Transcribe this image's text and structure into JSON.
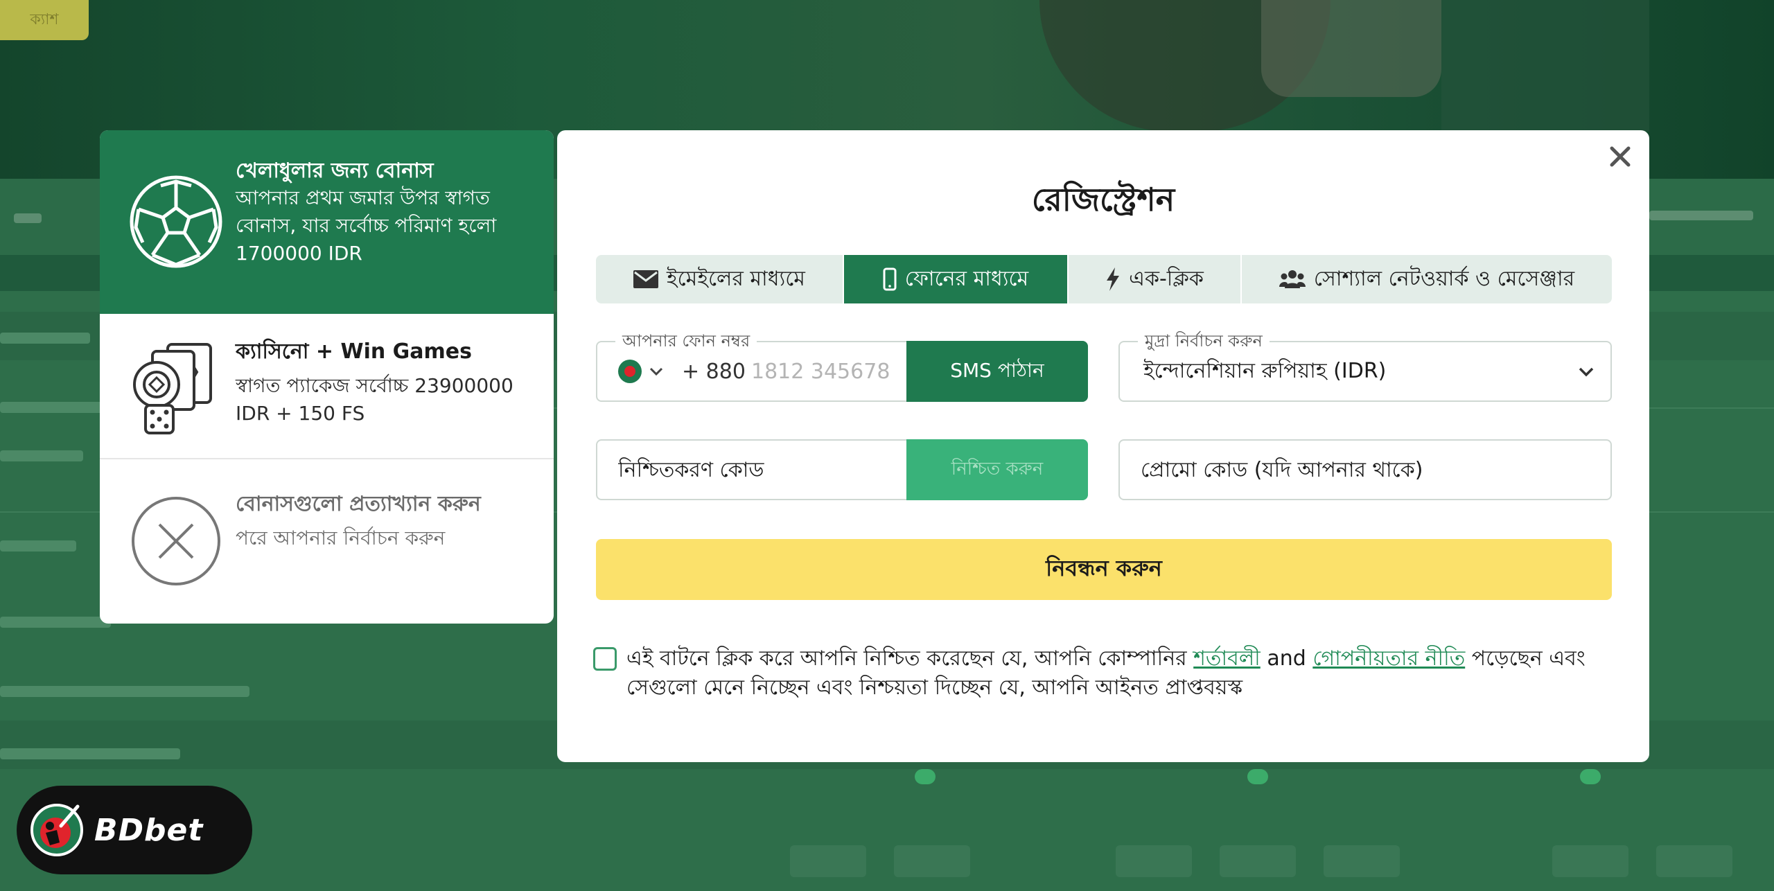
{
  "background": {
    "top_button_label": "ক্যাশ"
  },
  "bonus_panel": {
    "items": [
      {
        "title": "খেলাধুলার জন্য বোনাস",
        "description": "আপনার প্রথম জমার উপর স্বাগত বোনাস, যার সর্বোচ্চ পরিমাণ হলো 1700000 IDR",
        "icon": "soccer-ball-icon",
        "selected": true
      },
      {
        "title": "ক্যাসিনো + Win Games",
        "description": "স্বাগত প্যাকেজ সর্বোচ্চ 23900000 IDR + 150 FS",
        "icon": "casino-chips-icon",
        "selected": false
      },
      {
        "title": "বোনাসগুলো প্রত্যাখ্যান করুন",
        "description": "পরে আপনার নির্বাচন করুন",
        "icon": "decline-circle-icon",
        "selected": false
      }
    ]
  },
  "modal": {
    "title": "রেজিস্ট্রেশন",
    "close_icon": "close-icon",
    "tabs": [
      {
        "label": "ইমেইলের মাধ্যমে",
        "icon": "envelope-icon",
        "active": false
      },
      {
        "label": "ফোনের মাধ্যমে",
        "icon": "mobile-phone-icon",
        "active": true
      },
      {
        "label": "এক-ক্লিক",
        "icon": "lightning-icon",
        "active": false
      },
      {
        "label": "সোশ্যাল নেটওয়ার্ক ও মেসেঞ্জার",
        "icon": "users-icon",
        "active": false
      }
    ],
    "phone": {
      "legend": "আপনার ফোন নম্বর",
      "country_code": "+ 880",
      "placeholder": "1812 345678",
      "sms_button": "SMS পাঠান"
    },
    "currency": {
      "legend": "মুদ্রা নির্বাচন করুন",
      "value": "ইন্দোনেশিয়ান রুপিয়াহ (IDR)"
    },
    "confirmation": {
      "placeholder": "নিশ্চিতকরণ কোড",
      "button": "নিশ্চিত করুন"
    },
    "promo": {
      "placeholder": "প্রোমো কোড (যদি আপনার থাকে)"
    },
    "register_button": "নিবন্ধন করুন",
    "consent": {
      "text_before": "এই বাটনে ক্লিক করে আপনি নিশ্চিত করেছেন যে, আপনি কোম্পানির",
      "terms_link": "শর্তাবলী",
      "and": "and",
      "privacy_link": "গোপনীয়তার নীতি",
      "text_after": "পড়েছেন এবং সেগুলো মেনে নিচ্ছেন এবং নিশ্চয়তা দিচ্ছেন যে, আপনি আইনত প্রাপ্তবয়স্ক",
      "checked": false
    }
  },
  "logo": {
    "text": "BDbet"
  },
  "colors": {
    "brand_green": "#1f7a4f",
    "accent_yellow": "#fbe16b",
    "confirm_green": "#39b27a",
    "link_green": "#1f8a55"
  }
}
